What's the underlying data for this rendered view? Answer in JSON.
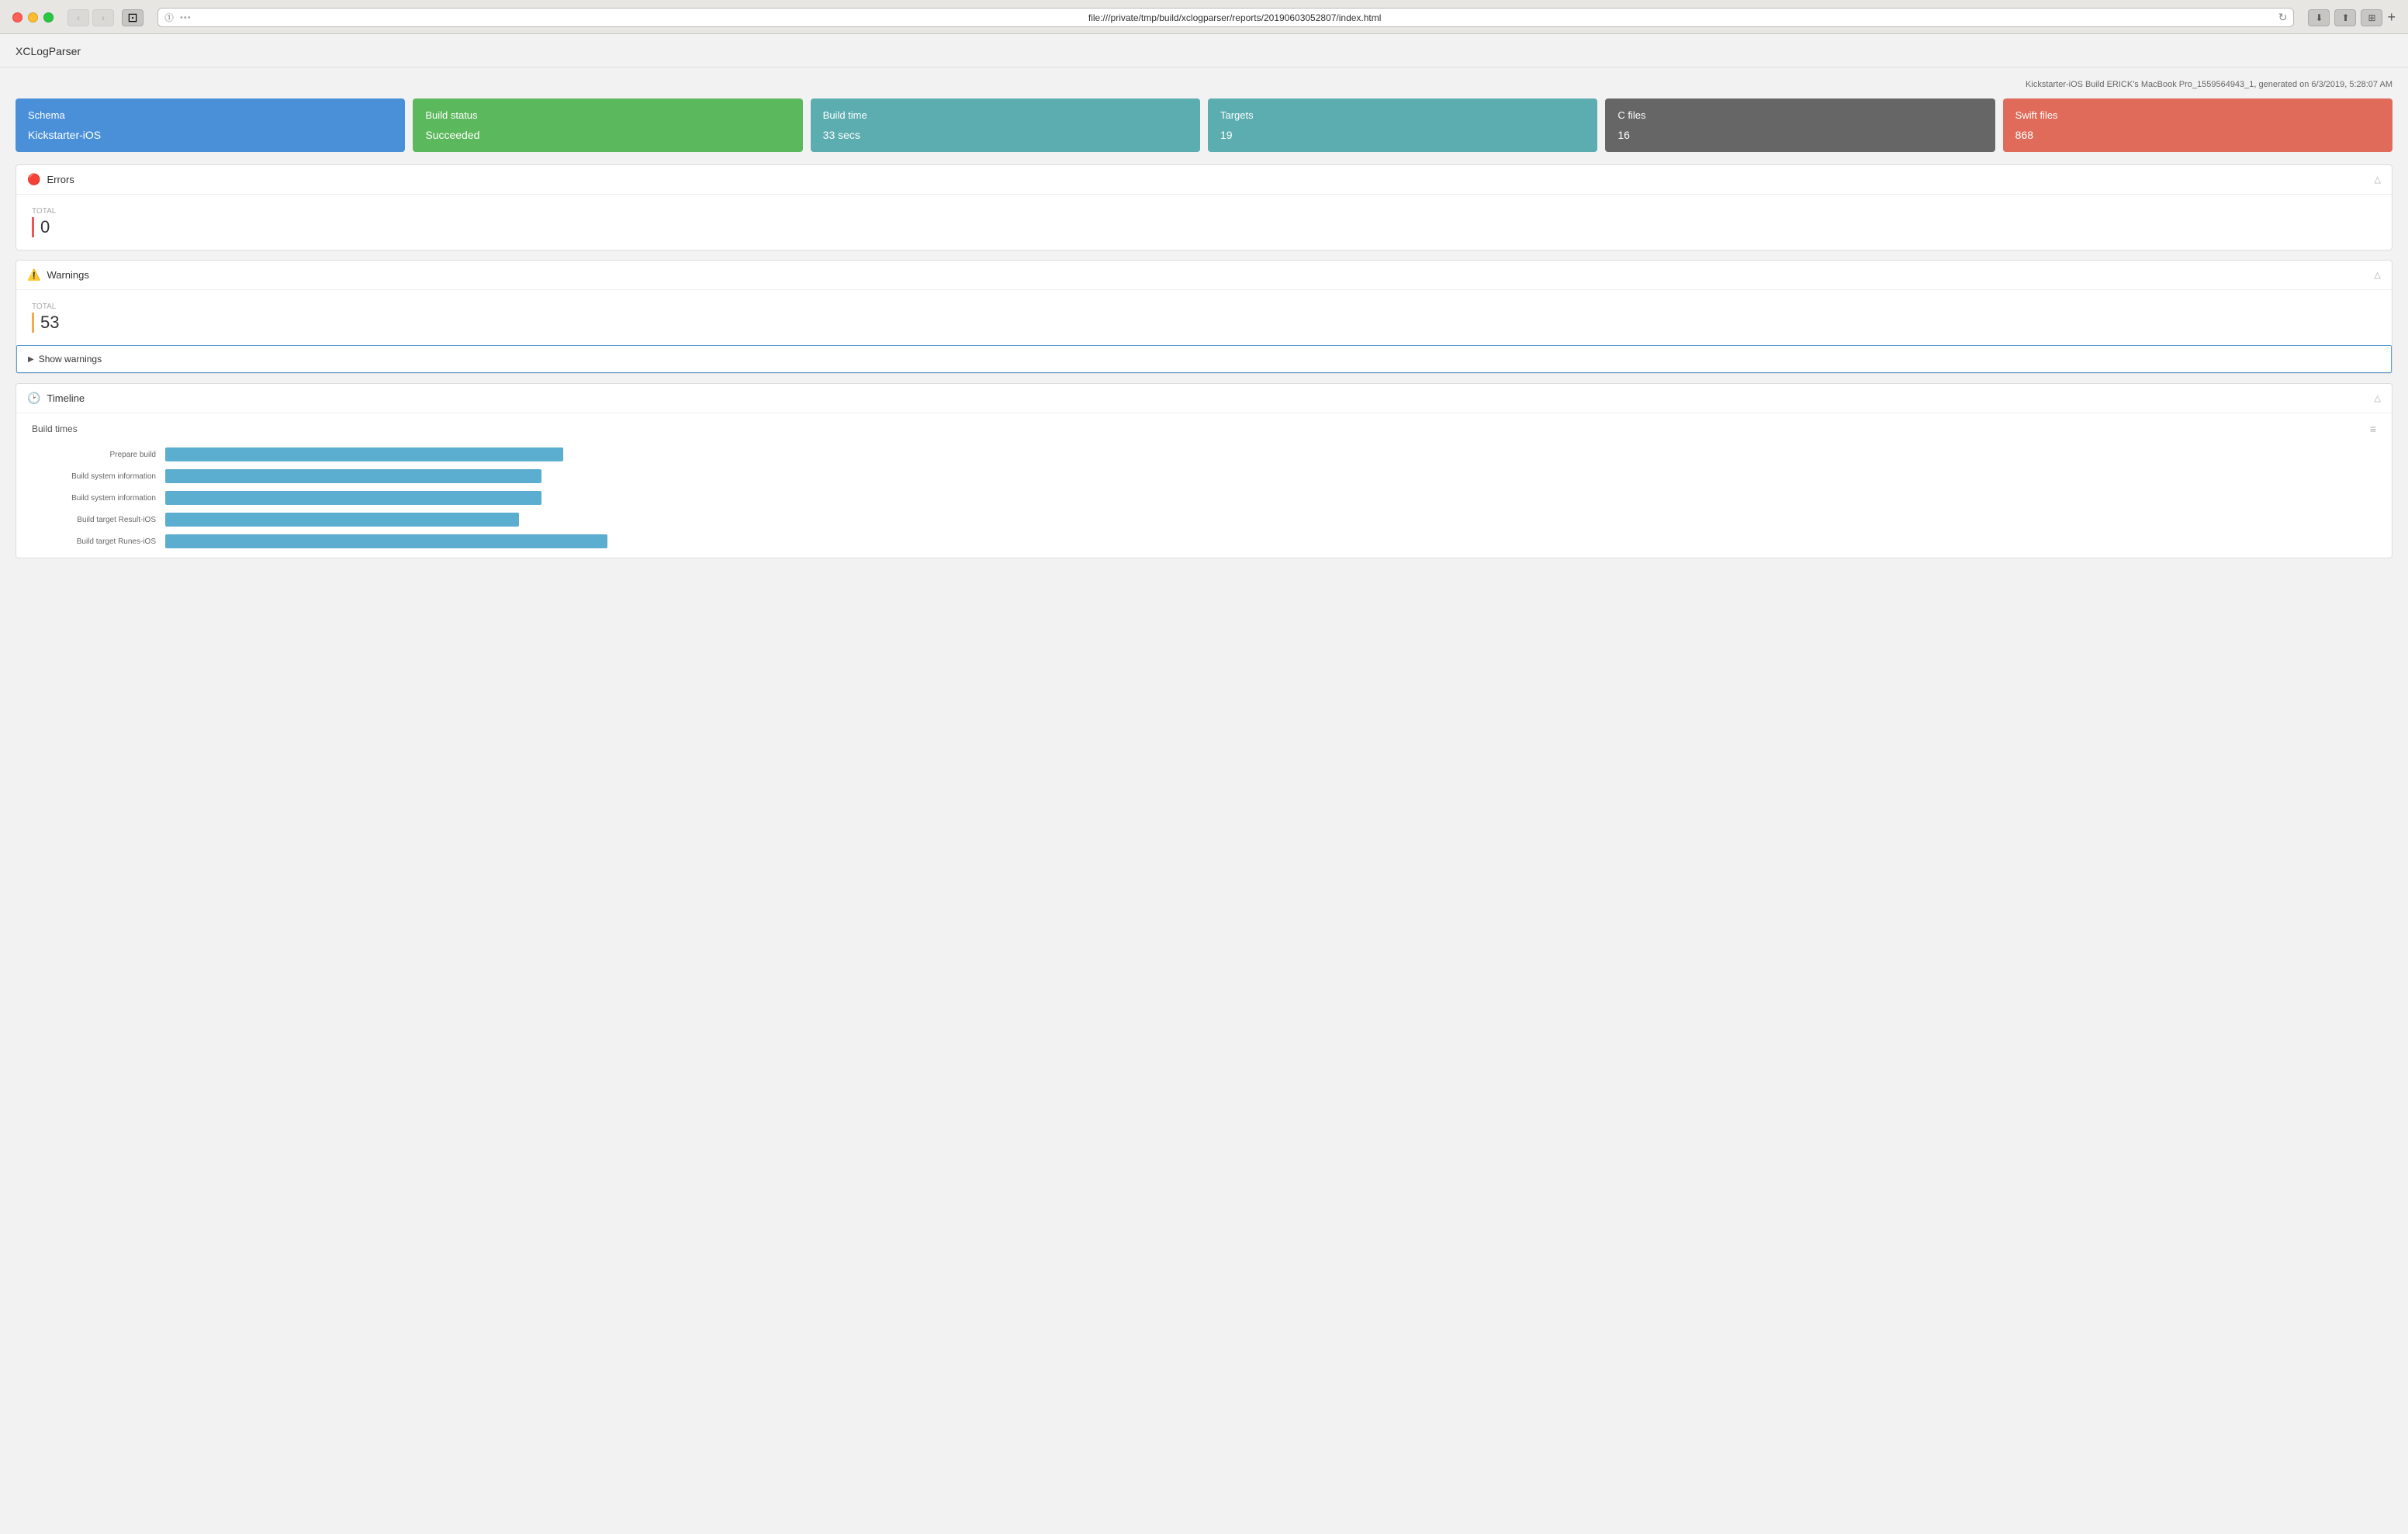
{
  "browser": {
    "url": "file:///private/tmp/build/xclogparser/reports/20190603052807/index.html",
    "traffic_lights": [
      "red",
      "yellow",
      "green"
    ],
    "nav_back_label": "‹",
    "nav_forward_label": "›",
    "sidebar_icon": "⊡",
    "dots_label": "•••",
    "add_tab_label": "+"
  },
  "app": {
    "title": "XCLogParser",
    "build_meta": "Kickstarter-iOS Build ERICK's MacBook Pro_1559564943_1, generated on 6/3/2019, 5:28:07 AM"
  },
  "stat_cards": [
    {
      "id": "schema",
      "label": "Schema",
      "value": "Kickstarter-iOS",
      "color_class": "card-schema"
    },
    {
      "id": "build-status",
      "label": "Build status",
      "value": "Succeeded",
      "color_class": "card-build-status"
    },
    {
      "id": "build-time",
      "label": "Build time",
      "value": "33 secs",
      "color_class": "card-build-time"
    },
    {
      "id": "targets",
      "label": "Targets",
      "value": "19",
      "color_class": "card-targets"
    },
    {
      "id": "c-files",
      "label": "C files",
      "value": "16",
      "color_class": "card-c-files"
    },
    {
      "id": "swift-files",
      "label": "Swift files",
      "value": "868",
      "color_class": "card-swift-files"
    }
  ],
  "sections": {
    "errors": {
      "title": "Errors",
      "icon": "🔴",
      "total_label": "Total",
      "total_value": "0",
      "color_class": "error"
    },
    "warnings": {
      "title": "Warnings",
      "icon": "⚠️",
      "total_label": "Total",
      "total_value": "53",
      "show_label": "Show warnings",
      "color_class": "warning"
    },
    "timeline": {
      "title": "Timeline",
      "icon": "🕐",
      "build_times_label": "Build times",
      "bars": [
        {
          "label": "Prepare build",
          "width_pct": 18
        },
        {
          "label": "Build system information",
          "width_pct": 17
        },
        {
          "label": "Build system information",
          "width_pct": 17
        },
        {
          "label": "Build target Result-iOS",
          "width_pct": 16
        },
        {
          "label": "Build target Runes-iOS",
          "width_pct": 20
        }
      ]
    }
  }
}
